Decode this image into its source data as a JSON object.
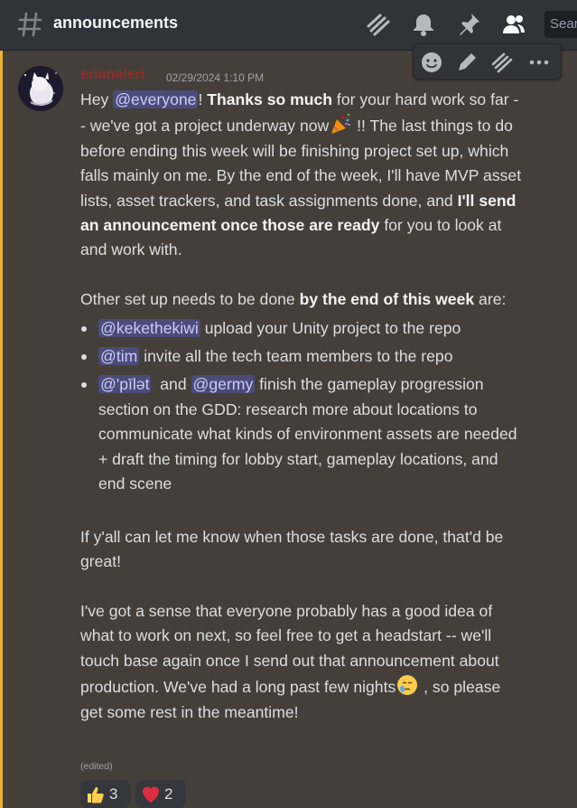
{
  "header": {
    "channel_name": "announcements",
    "search_placeholder": "Search"
  },
  "message": {
    "author": "eriane/eri",
    "timestamp": "02/29/2024 1:10 PM",
    "author_color": "#8d2e2b",
    "p1": {
      "t1": "Hey ",
      "mention_everyone": "@everyone",
      "t2": "! ",
      "b1": "Thanks so much",
      "t3": " for your hard work so far -- we've got a project underway now",
      "t4": " !! The last things to do before ending this week will be finishing project set up, which falls mainly on me. By the end of the week, I'll have MVP asset lists, asset trackers, and task assignments done, and ",
      "b2": "I'll send an announcement once those are ready",
      "t5": " for you to look at and work with."
    },
    "p2": {
      "t1": "Other set up needs to be done ",
      "b1": "by the end of this week",
      "t2": " are:"
    },
    "tasks": [
      {
        "mention": "@kekethekiwi",
        "text": " upload your Unity project to the repo"
      },
      {
        "mention": "@tim",
        "text": " invite all the tech team members to the repo"
      },
      {
        "mention": "@'pīlət",
        "mid": "  and ",
        "mention2": "@germy",
        "text": " finish the gameplay progression section on the GDD: research more about locations to communicate what kinds of environment assets are needed + draft the timing for lobby start, gameplay locations, and end scene"
      }
    ],
    "p3": "If y'all can let me know when those tasks are done, that'd be great!",
    "p4": {
      "t1": "I've got a sense that everyone probably has a good idea of what to work on next, so feel free to get a headstart -- we'll touch base again once I send out that announcement about production. We've had a long past few nights",
      "t2": " , so please get some rest in the meantime!"
    },
    "edited_label": "(edited)"
  },
  "reactions": [
    {
      "emoji": "thumbs-up",
      "count": "3"
    },
    {
      "emoji": "red-heart",
      "count": "2"
    }
  ],
  "colors": {
    "accent": "#f0b232",
    "mention_bg": "#5865f2",
    "background": "#444039"
  },
  "icons": [
    "hash-icon",
    "threads-icon",
    "bell-icon",
    "pin-icon",
    "members-icon",
    "add-reaction-icon",
    "edit-icon",
    "thread-icon",
    "more-icon",
    "party-popper-icon",
    "crying-face-icon"
  ]
}
